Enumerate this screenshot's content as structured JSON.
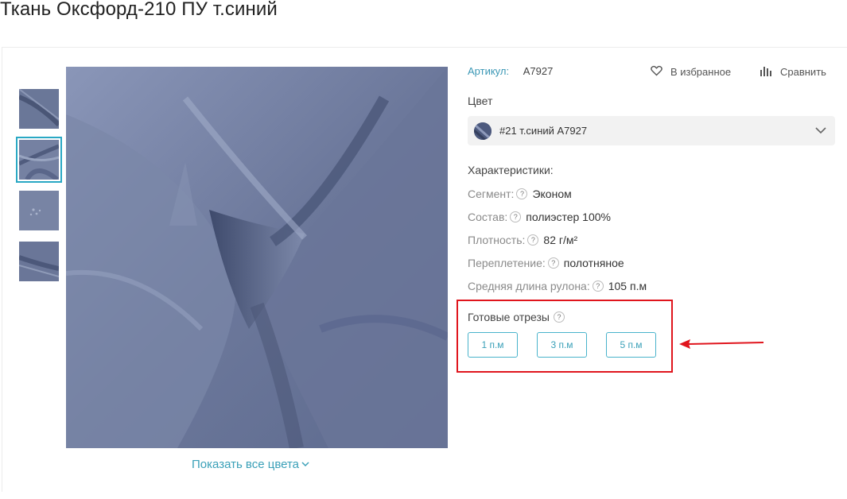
{
  "product": {
    "title": "Ткань Оксфорд-210 ПУ т.синий",
    "sku_label": "Артикул:",
    "sku_value": "A7927"
  },
  "actions": {
    "favorite_label": "В избранное",
    "compare_label": "Сравнить"
  },
  "color": {
    "label": "Цвет",
    "selected": "#21 т.синий A7927"
  },
  "characteristics": {
    "title": "Характеристики:",
    "items": [
      {
        "key": "Сегмент:",
        "value": "Эконом"
      },
      {
        "key": "Состав:",
        "value": "полиэстер 100%"
      },
      {
        "key": "Плотность:",
        "value": "82 г/м²"
      },
      {
        "key": "Переплетение:",
        "value": "полотняное"
      },
      {
        "key": "Средняя длина рулона:",
        "value": "105 п.м"
      }
    ]
  },
  "cuts": {
    "title": "Готовые отрезы",
    "options": [
      "1 п.м",
      "3 п.м",
      "5 п.м"
    ]
  },
  "gallery": {
    "show_all_colors": "Показать все цвета",
    "thumbnails": 4,
    "active_thumbnail": 2
  },
  "help_icon": "?",
  "colors": {
    "accent": "#3aa0b8",
    "highlight": "#e0151d",
    "fabric": "#6f7b9e"
  }
}
